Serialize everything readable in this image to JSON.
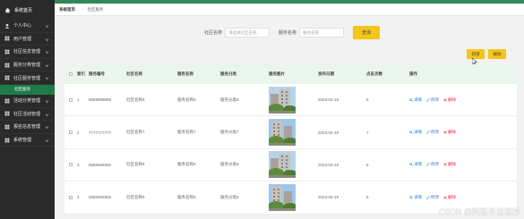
{
  "sidebar": {
    "logo_label": "系统首页",
    "items": [
      {
        "label": "个人中心",
        "icon": "user-icon"
      },
      {
        "label": "用户管理",
        "icon": "grid-icon"
      },
      {
        "label": "社区信息管理",
        "icon": "grid-icon"
      },
      {
        "label": "服务分类管理",
        "icon": "grid-icon"
      },
      {
        "label": "社区服务管理",
        "icon": "grid-icon"
      }
    ],
    "active_sub": "社区服务",
    "items_after": [
      {
        "label": "活动分类管理",
        "icon": "grid-icon"
      },
      {
        "label": "社区活动管理",
        "icon": "grid-icon"
      },
      {
        "label": "报名信息管理",
        "icon": "grid-icon"
      },
      {
        "label": "系统管理",
        "icon": "grid-icon"
      }
    ]
  },
  "breadcrumb": {
    "home": "系统首页",
    "current": "社区服务"
  },
  "search": {
    "community_label": "社区名称",
    "community_placeholder": "请选择社区名称",
    "service_label": "服务名称",
    "service_placeholder": "服务名称",
    "query_label": "查询"
  },
  "toolbar": {
    "add_label": "新增",
    "delete_label": "删除"
  },
  "table": {
    "headers": {
      "index": "索引",
      "no": "服务编号",
      "name": "社区名称",
      "service": "服务名称",
      "category": "服务分类",
      "image": "服务图片",
      "date": "发布日期",
      "views": "点击次数",
      "ops": "操作"
    },
    "ops": {
      "detail": "详情",
      "edit": "修改",
      "delete": "删除"
    },
    "rows": [
      {
        "index": "1",
        "no": "8888888888",
        "name": "社区名称8",
        "service": "服务名称8",
        "category": "服务分类8",
        "date": "2023-04-19",
        "views": "8"
      },
      {
        "index": "2",
        "no": "7777777777",
        "name": "社区名称7",
        "service": "服务名称7",
        "category": "服务分类7",
        "date": "2023-04-19",
        "views": "7"
      },
      {
        "index": "3",
        "no": "6666666666",
        "name": "社区名称6",
        "service": "服务名称6",
        "category": "服务分类6",
        "date": "2023-04-19",
        "views": "6"
      },
      {
        "index": "4",
        "no": "5555555555",
        "name": "社区名称5",
        "service": "服务名称5",
        "category": "服务分类5",
        "date": "2023-04-19",
        "views": "5"
      }
    ]
  },
  "watermark": "CSDN @阿联毕设程序",
  "colors": {
    "sidebar_bg": "#2a2a2a",
    "accent_green": "#2e8b57",
    "active_sub_bg": "#1f7a4a",
    "button_yellow": "#f5c518",
    "link_blue": "#2a7ae2",
    "delete_red": "#ee2233",
    "header_bg": "#eaf5ee"
  }
}
